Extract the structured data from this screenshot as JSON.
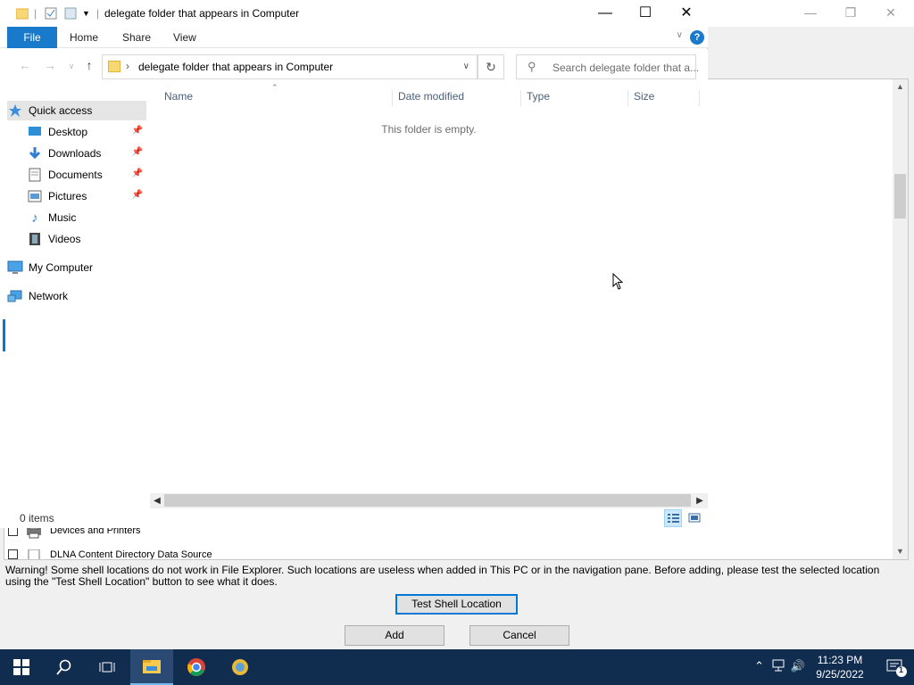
{
  "explorer": {
    "title": "delegate folder that appears in Computer",
    "ribbon_tabs": [
      "File",
      "Home",
      "Share",
      "View"
    ],
    "help_label": "?",
    "address_path": "delegate folder that appears in Computer",
    "search_placeholder": "Search delegate folder that a...",
    "nav": {
      "quick_access": "Quick access",
      "desktop": "Desktop",
      "downloads": "Downloads",
      "documents": "Documents",
      "pictures": "Pictures",
      "music": "Music",
      "videos": "Videos",
      "my_computer": "My Computer",
      "network": "Network"
    },
    "columns": [
      "Name",
      "Date modified",
      "Type",
      "Size"
    ],
    "empty_message": "This folder is empty.",
    "status_count": "0 items"
  },
  "dialog": {
    "list_items": [
      "Devices and Printers",
      "DLNA Content Directory Data Source"
    ],
    "warning": "Warning! Some shell locations do not work in File Explorer. Such locations are useless when added in This PC or in the navigation pane. Before adding, please test the selected location using the \"Test Shell Location\" button to see what it does.",
    "test_button": "Test Shell Location",
    "add_button": "Add",
    "cancel_button": "Cancel"
  },
  "taskbar": {
    "time": "11:23 PM",
    "date": "9/25/2022",
    "notification_count": "1"
  },
  "colors": {
    "accent": "#0078d7",
    "file_tab": "#1979ca",
    "taskbar": "#102c4f"
  }
}
